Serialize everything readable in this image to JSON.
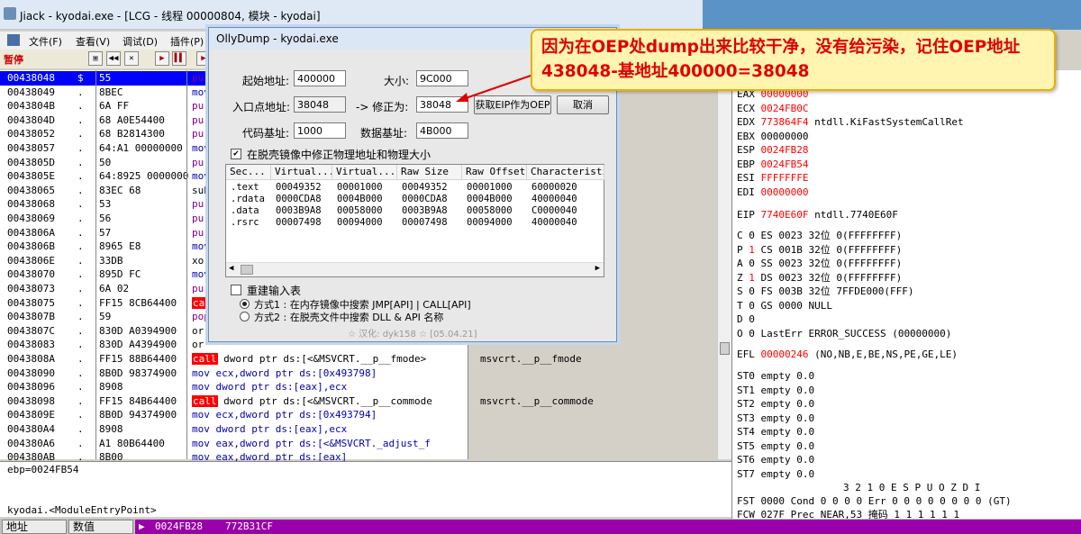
{
  "window": {
    "title": "Jiack   - kyodai.exe - [LCG - 线程 00000804, 模块 - kyodai]"
  },
  "menu": [
    "文件(F)",
    "查看(V)",
    "调试(D)",
    "插件(P)"
  ],
  "toolbar": {
    "status": "暂停"
  },
  "cpu": {
    "rows": [
      {
        "addr": "00438048",
        "hex": "55",
        "dis": "pu"
      },
      {
        "addr": "00438049",
        "hex": "8BEC",
        "dis": "mov"
      },
      {
        "addr": "0043804B",
        "hex": "6A FF",
        "dis": "pu"
      },
      {
        "addr": "0043804D",
        "hex": "68 A0E54400",
        "dis": "pu"
      },
      {
        "addr": "00438052",
        "hex": "68 B2814300",
        "dis": "pu"
      },
      {
        "addr": "00438057",
        "hex": "64:A1 00000000",
        "dis": "mov"
      },
      {
        "addr": "0043805D",
        "hex": "50",
        "dis": "pu"
      },
      {
        "addr": "0043805E",
        "hex": "64:8925 00000000",
        "dis": "mov"
      },
      {
        "addr": "00438065",
        "hex": "83EC 68",
        "dis": "sub"
      },
      {
        "addr": "00438068",
        "hex": "53",
        "dis": "pu"
      },
      {
        "addr": "00438069",
        "hex": "56",
        "dis": "pu"
      },
      {
        "addr": "0043806A",
        "hex": "57",
        "dis": "pu"
      },
      {
        "addr": "0043806B",
        "hex": "8965 E8",
        "dis": "mov"
      },
      {
        "addr": "0043806E",
        "hex": "33DB",
        "dis": "xor"
      },
      {
        "addr": "00438070",
        "hex": "895D FC",
        "dis": "mov"
      },
      {
        "addr": "00438073",
        "hex": "6A 02",
        "dis": "pu"
      },
      {
        "addr": "00438075",
        "hex": "FF15 8CB64400",
        "dis": "cal"
      },
      {
        "addr": "0043807B",
        "hex": "59",
        "dis": "pop"
      },
      {
        "addr": "0043807C",
        "hex": "830D A0394900",
        "dis": "or"
      },
      {
        "addr": "00438083",
        "hex": "830D A4394900",
        "dis": "or"
      },
      {
        "addr": "0043808A",
        "hex": "FF15 88B64400",
        "dis": "call dword ptr ds:[<&MSVCRT.__p__fmode>",
        "cmt": "msvcrt.__p__fmode"
      },
      {
        "addr": "00438090",
        "hex": "8B0D 98374900",
        "dis": "mov ecx,dword ptr ds:[0x493798]"
      },
      {
        "addr": "00438096",
        "hex": "8908",
        "dis": "mov dword ptr ds:[eax],ecx"
      },
      {
        "addr": "00438098",
        "hex": "FF15 84B64400",
        "dis": "call dword ptr ds:[<&MSVCRT.__p__commode",
        "cmt": "msvcrt.__p__commode"
      },
      {
        "addr": "0043809E",
        "hex": "8B0D 94374900",
        "dis": "mov ecx,dword ptr ds:[0x493794]"
      },
      {
        "addr": "004380A4",
        "hex": "8908",
        "dis": "mov dword ptr ds:[eax],ecx"
      },
      {
        "addr": "004380A6",
        "hex": "A1 80B64400",
        "dis": "mov eax,dword ptr ds:[<&MSVCRT._adjust_f"
      },
      {
        "addr": "004380AB",
        "hex": "8B00",
        "dis": "mov eax,dword ptr ds:[eax]"
      }
    ],
    "row1_marker": "$",
    "row2_marker": "."
  },
  "info": {
    "line1": "ebp=0024FB54",
    "line2": "kyodai.<ModuleEntryPoint>"
  },
  "dump": {
    "col_addr": "地址",
    "col_val": "数值",
    "addr": "0024FB28",
    "val": "772B31CF"
  },
  "registers": [
    {
      "name": "EAX",
      "val": "00000000",
      "red": true
    },
    {
      "name": "ECX",
      "val": "0024FB0C",
      "red": true
    },
    {
      "name": "EDX",
      "val": "773864F4",
      "red": true,
      "sym": "ntdll.KiFastSystemCallRet"
    },
    {
      "name": "EBX",
      "val": "00000000",
      "red": false
    },
    {
      "name": "ESP",
      "val": "0024FB28",
      "red": true
    },
    {
      "name": "EBP",
      "val": "0024FB54",
      "red": true
    },
    {
      "name": "ESI",
      "val": "FFFFFFFE",
      "red": true
    },
    {
      "name": "EDI",
      "val": "00000000",
      "red": true
    },
    {
      "name": "EIP",
      "val": "7740E60F",
      "red": true,
      "sym": "ntdll.7740E60F"
    }
  ],
  "flags": [
    "C 0  ES 0023 32位 0(FFFFFFFF)",
    "P 1  CS 001B 32位 0(FFFFFFFF)",
    "A 0  SS 0023 32位 0(FFFFFFFF)",
    "Z 1  DS 0023 32位 0(FFFFFFFF)",
    "S 0  FS 003B 32位 7FFDE000(FFF)",
    "T 0  GS 0000 NULL",
    "D 0",
    "O 0  LastErr ERROR_SUCCESS (00000000)"
  ],
  "efl": {
    "label": "EFL",
    "val": "00000246",
    "desc": "(NO,NB,E,BE,NS,PE,GE,LE)"
  },
  "fpu": [
    "ST0 empty 0.0",
    "ST1 empty 0.0",
    "ST2 empty 0.0",
    "ST3 empty 0.0",
    "ST4 empty 0.0",
    "ST5 empty 0.0",
    "ST6 empty 0.0",
    "ST7 empty 0.0"
  ],
  "fpu_hdr": "3 2 1 0      E S P U O Z D I",
  "fst": "FST 0000  Cond 0 0 0 0  Err 0 0 0 0 0 0 0 0  (GT)",
  "fcw": "FCW 027F  Prec NEAR,53  掩码    1 1 1 1 1 1",
  "dialog": {
    "title": "OllyDump - kyodai.exe",
    "start_label": "起始地址:",
    "start_val": "400000",
    "size_label": "大小:",
    "size_val": "9C000",
    "ep_label": "入口点地址:",
    "ep_val": "38048",
    "fix_label": "-> 修正为:",
    "fix_val": "38048",
    "getip_btn": "获取EIP作为OEP",
    "cancel_btn": "取消",
    "code_label": "代码基址:",
    "code_val": "1000",
    "data_label": "数据基址:",
    "data_val": "4B000",
    "fix_check": "在脱壳镜像中修正物理地址和物理大小",
    "fix_check_mark": "✔",
    "table": {
      "headers": [
        "Sec...",
        "Virtual...",
        "Virtual...",
        "Raw Size",
        "Raw Offset",
        "Characteristi"
      ],
      "rows": [
        [
          ".text",
          "00049352",
          "00001000",
          "00049352",
          "00001000",
          "60000020"
        ],
        [
          ".rdata",
          "0000CDA8",
          "0004B000",
          "0000CDA8",
          "0004B000",
          "40000040"
        ],
        [
          ".data",
          "0003B9A8",
          "00058000",
          "0003B9A8",
          "00058000",
          "C0000040"
        ],
        [
          ".rsrc",
          "00007498",
          "00094000",
          "00007498",
          "00094000",
          "40000040"
        ]
      ]
    },
    "rebuild_label": "重建输入表",
    "method1": "方式1 : 在内存镜像中搜索 JMP[API] | CALL[API]",
    "method2": "方式2 : 在脱壳文件中搜索 DLL & API 名称",
    "credit": "☆ 汉化: dyk158 ☆ [05.04.21]"
  },
  "annotation": {
    "text": "因为在OEP处dump出来比较干净，没有给污染，记住OEP地址438048-基地址400000=38048"
  }
}
